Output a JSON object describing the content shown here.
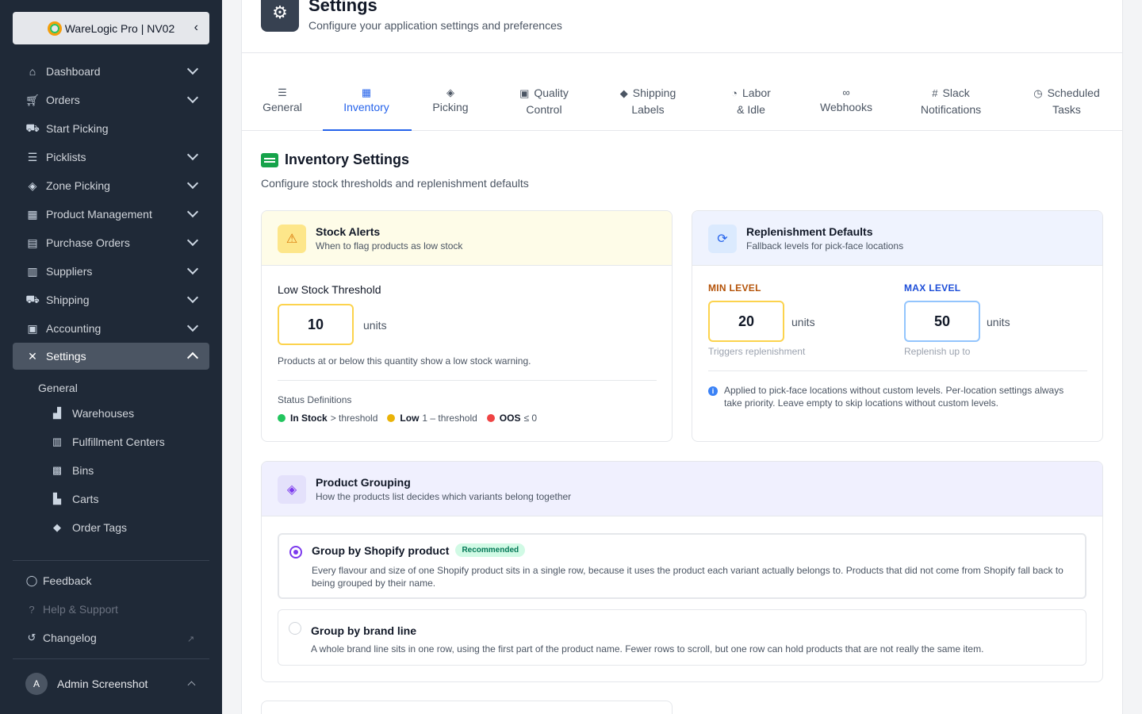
{
  "sidebar": {
    "brand": "WareLogic Pro | NV02",
    "items": [
      {
        "label": "Dashboard",
        "icon": "home-icon"
      },
      {
        "label": "Orders",
        "icon": "cart-icon"
      },
      {
        "label": "Start Picking",
        "icon": "dolly-icon"
      },
      {
        "label": "Picklists",
        "icon": "list-icon"
      },
      {
        "label": "Zone Picking",
        "icon": "layers-icon"
      },
      {
        "label": "Product Management",
        "icon": "cubes-icon"
      },
      {
        "label": "Purchase Orders",
        "icon": "file-icon"
      },
      {
        "label": "Suppliers",
        "icon": "warehouse-icon"
      },
      {
        "label": "Shipping",
        "icon": "truck-icon"
      },
      {
        "label": "Accounting",
        "icon": "calculator-icon"
      },
      {
        "label": "Settings",
        "icon": "tools-icon"
      }
    ],
    "settings_sub": {
      "general": "General",
      "items": [
        "Warehouses",
        "Fulfillment Centers",
        "Bins",
        "Carts",
        "Order Tags"
      ]
    },
    "footer": {
      "feedback": "Feedback",
      "help": "Help & Support",
      "changelog": "Changelog"
    },
    "user": {
      "initial": "A",
      "name": "Admin Screenshot"
    }
  },
  "page": {
    "title": "Settings",
    "subtitle": "Configure your application settings and preferences"
  },
  "tabs": [
    {
      "line1": "General",
      "line2": ""
    },
    {
      "line1": "Inventory",
      "line2": ""
    },
    {
      "line1": "Picking",
      "line2": ""
    },
    {
      "line1": "Quality",
      "line2": "Control"
    },
    {
      "line1": "Shipping",
      "line2": "Labels"
    },
    {
      "line1": "Labor",
      "line2": "& Idle"
    },
    {
      "line1": "Webhooks",
      "line2": ""
    },
    {
      "line1": "Slack",
      "line2": "Notifications"
    },
    {
      "line1": "Scheduled",
      "line2": "Tasks"
    }
  ],
  "section": {
    "title": "Inventory Settings",
    "subtitle": "Configure stock thresholds and replenishment defaults"
  },
  "stock_alerts": {
    "title": "Stock Alerts",
    "subtitle": "When to flag products as low stock",
    "threshold_label": "Low Stock Threshold",
    "threshold_value": "10",
    "unit": "units",
    "hint": "Products at or below this quantity show a low stock warning.",
    "status_heading": "Status Definitions",
    "statuses": [
      {
        "name": "In Stock",
        "rule": "> threshold",
        "color": "#22c55e"
      },
      {
        "name": "Low",
        "rule": "1 – threshold",
        "color": "#eab308"
      },
      {
        "name": "OOS",
        "rule": "≤ 0",
        "color": "#ef4444"
      }
    ]
  },
  "replenishment": {
    "title": "Replenishment Defaults",
    "subtitle": "Fallback levels for pick-face locations",
    "min_label": "MIN LEVEL",
    "min_value": "20",
    "min_hint": "Triggers replenishment",
    "max_label": "MAX LEVEL",
    "max_value": "50",
    "max_hint": "Replenish up to",
    "unit": "units",
    "info": "Applied to pick-face locations without custom levels. Per-location settings always take priority. Leave empty to skip locations without custom levels."
  },
  "grouping": {
    "title": "Product Grouping",
    "subtitle": "How the products list decides which variants belong together",
    "options": [
      {
        "title": "Group by Shopify product",
        "badge": "Recommended",
        "desc": "Every flavour and size of one Shopify product sits in a single row, because it uses the product each variant actually belongs to. Products that did not come from Shopify fall back to being grouped by their name.",
        "selected": true
      },
      {
        "title": "Group by brand line",
        "badge": "",
        "desc": "A whole brand line sits in one row, using the first part of the product name. Fewer rows to scroll, but one row can hold products that are not really the same item.",
        "selected": false
      }
    ]
  },
  "colors": {
    "sidebar_bg": "#1f2937",
    "accent": "#2563eb",
    "min_accent": "#b45309",
    "max_accent": "#1d4ed8",
    "radio_accent": "#7c3aed"
  }
}
